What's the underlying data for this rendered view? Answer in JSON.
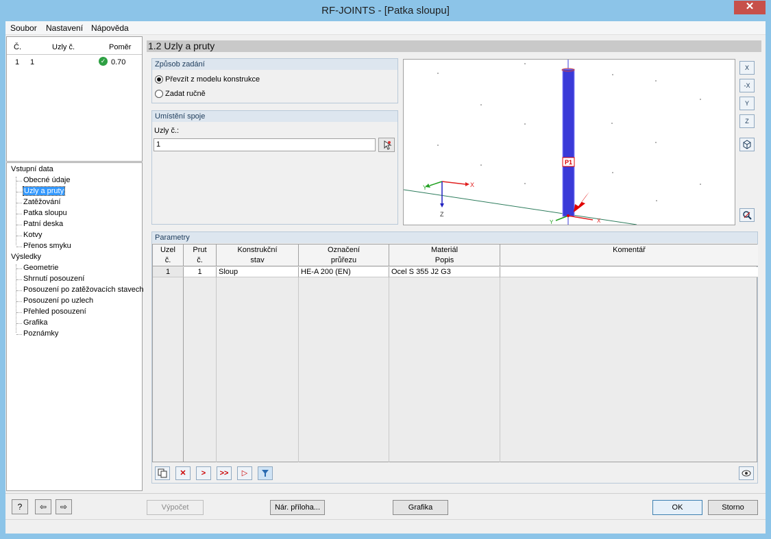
{
  "window": {
    "title": "RF-JOINTS - [Patka sloupu]",
    "close_glyph": "✕"
  },
  "menu": {
    "items": [
      "Soubor",
      "Nastavení",
      "Nápověda"
    ]
  },
  "left_table": {
    "headers": [
      "Č.",
      "Uzly č.",
      "Poměr"
    ],
    "rows": [
      {
        "no": "1",
        "nodes": "1",
        "ratio": "0.70"
      }
    ]
  },
  "nav": {
    "input_group": "Vstupní data",
    "input_items": [
      "Obecné údaje",
      "Uzly a pruty",
      "Zatěžování",
      "Patka sloupu",
      "Patní deska",
      "Kotvy",
      "Přenos smyku"
    ],
    "results_group": "Výsledky",
    "results_items": [
      "Geometrie",
      "Shrnutí posouzení",
      "Posouzení po zatěžovacích stavech",
      "Posouzení po uzlech",
      "Přehled posouzení",
      "Grafika",
      "Poznámky"
    ],
    "selected": "Uzly a pruty"
  },
  "section": {
    "title": "1.2 Uzly a pruty"
  },
  "input_mode": {
    "title": "Způsob zadání",
    "options": [
      "Převzít z modelu konstrukce",
      "Zadat ručně"
    ],
    "selected_index": 0
  },
  "joint_location": {
    "title": "Umístění spoje",
    "nodes_label": "Uzly č.:",
    "nodes_value": "1"
  },
  "viewport": {
    "member_label": "P1",
    "axes": {
      "x": "X",
      "y": "Y",
      "z": "Z"
    },
    "colors": {
      "member": "#3a3ad8",
      "x_axis": "#e02020",
      "y_axis": "#20a020",
      "z_axis": "#2020c0",
      "arrow": "#e00000"
    }
  },
  "side_tools": {
    "icons": [
      "view-x-icon",
      "view-minus-x-icon",
      "view-y-icon",
      "view-z-icon",
      "iso-view-icon",
      "zoom-reset-icon"
    ],
    "labels": [
      "X",
      "-X",
      "Y",
      "Z"
    ]
  },
  "parameters": {
    "title": "Parametry",
    "headers": [
      [
        "Uzel",
        "č."
      ],
      [
        "Prut",
        "č."
      ],
      [
        "Konstrukční",
        "stav"
      ],
      [
        "Označení",
        "průřezu"
      ],
      [
        "Materiál",
        "Popis"
      ],
      [
        "",
        "Komentář"
      ]
    ],
    "row": {
      "node": "1",
      "member": "1",
      "state": "Sloup",
      "section": "HE-A 200 (EN)",
      "material": "Ocel S 355 J2 G3",
      "comment": ""
    }
  },
  "bottom": {
    "calc": "Výpočet",
    "annex": "Nár. příloha...",
    "graphics": "Grafika",
    "ok": "OK",
    "cancel": "Storno"
  }
}
